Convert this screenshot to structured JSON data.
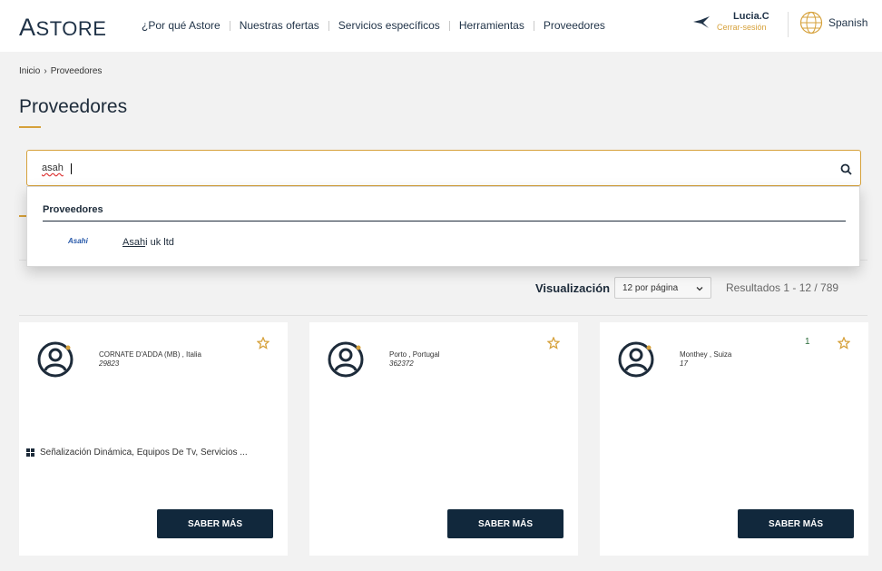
{
  "header": {
    "logo_first": "A",
    "logo_rest": "STORE",
    "nav": [
      "¿Por qué Astore",
      "Nuestras ofertas",
      "Servicios específicos",
      "Herramientas",
      "Proveedores"
    ],
    "user_name": "Lucia.C",
    "logout": "Cerrar-sesión",
    "language": "Spanish"
  },
  "breadcrumb": {
    "home": "Inicio",
    "current": "Proveedores"
  },
  "page_title": "Proveedores",
  "search": {
    "value": "asah"
  },
  "dropdown": {
    "heading": "Proveedores",
    "logo_text": "Asahi",
    "result_highlight": "Asah",
    "result_rest": "i uk ltd"
  },
  "results": {
    "label": "Visualización",
    "per_page": "12 por página",
    "count": "Resultados 1 - 12 / 789"
  },
  "cards": [
    {
      "location": "CORNATE D'ADDA (MB) , Italia",
      "code": "29823",
      "category": "Señalización Dinámica, Equipos De Tv, Servicios ...",
      "button": "SABER MÁS"
    },
    {
      "location": "Porto , Portugal",
      "code": "362372",
      "category": "",
      "button": "SABER MÁS"
    },
    {
      "location": "Monthey , Suiza",
      "code": "17",
      "category": "",
      "button": "SABER MÁS",
      "mark": "1"
    }
  ],
  "colors": {
    "accent": "#d6a13b",
    "navy": "#11283c"
  }
}
